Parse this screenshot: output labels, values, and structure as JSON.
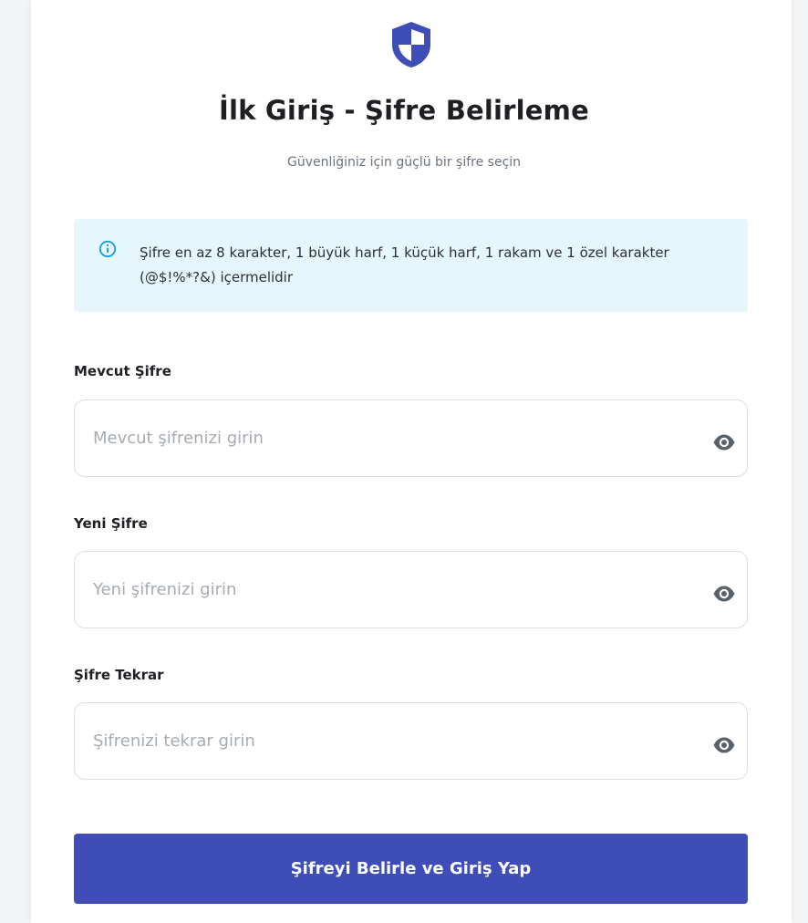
{
  "header": {
    "icon": "shield-icon",
    "title": "İlk Giriş - Şifre Belirleme",
    "subtitle": "Güvenliğiniz için güçlü bir şifre seçin"
  },
  "info": {
    "icon": "info-icon",
    "text": "Şifre en az 8 karakter, 1 büyük harf, 1 küçük harf, 1 rakam ve 1 özel karakter (@$!%*?&) içermelidir"
  },
  "fields": [
    {
      "label": "Mevcut Şifre",
      "placeholder": "Mevcut şifrenizi girin",
      "value": ""
    },
    {
      "label": "Yeni Şifre",
      "placeholder": "Yeni şifrenizi girin",
      "value": ""
    },
    {
      "label": "Şifre Tekrar",
      "placeholder": "Şifrenizi tekrar girin",
      "value": ""
    }
  ],
  "submit": {
    "label": "Şifreyi Belirle ve Giriş Yap"
  },
  "colors": {
    "primary": "#3f4db8",
    "info_background": "#e6f6fd",
    "info_icon": "#1a9ad6"
  }
}
